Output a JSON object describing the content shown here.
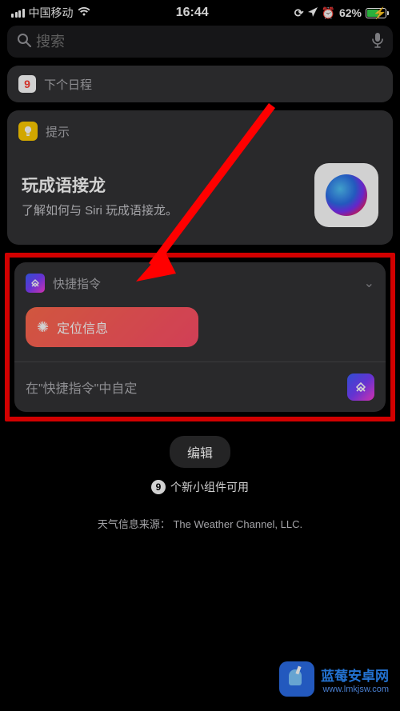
{
  "status": {
    "carrier": "中国移动",
    "time": "16:44",
    "battery_pct": "62%"
  },
  "search": {
    "placeholder": "搜索"
  },
  "calendar": {
    "title": "下个日程",
    "day": "9"
  },
  "tips": {
    "title": "提示",
    "headline": "玩成语接龙",
    "subtitle": "了解如何与 Siri 玩成语接龙。"
  },
  "shortcuts": {
    "title": "快捷指令",
    "chip_label": "定位信息",
    "customize": "在\"快捷指令\"中自定"
  },
  "edit_label": "编辑",
  "widgets_available": {
    "count": "9",
    "suffix": "个新小组件可用"
  },
  "weather_source": "天气信息来源：  The Weather Channel, LLC.",
  "watermark": {
    "title": "蓝莓安卓网",
    "url": "www.lmkjsw.com"
  }
}
